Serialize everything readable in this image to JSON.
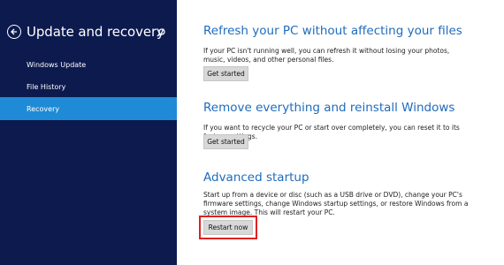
{
  "sidebar": {
    "title": "Update and recovery",
    "items": [
      {
        "label": "Windows Update"
      },
      {
        "label": "File History"
      },
      {
        "label": "Recovery"
      }
    ]
  },
  "sections": [
    {
      "title": "Refresh your PC without affecting your files",
      "description": "If your PC isn't running well, you can refresh it without losing your photos, music, videos, and other personal files.",
      "button": "Get started"
    },
    {
      "title": "Remove everything and reinstall Windows",
      "description": "If you want to recycle your PC or start over completely, you can reset it to its factory settings.",
      "button": "Get started"
    },
    {
      "title": "Advanced startup",
      "description": "Start up from a device or disc (such as a USB drive or DVD), change your PC's firmware settings, change Windows startup settings, or restore Windows from a system image. This will restart your PC.",
      "button": "Restart now"
    }
  ],
  "colors": {
    "sidebar_bg": "#0c1a4e",
    "selected_bg": "#1f8bd6",
    "heading": "#1f6bbd",
    "highlight": "#e02020"
  }
}
